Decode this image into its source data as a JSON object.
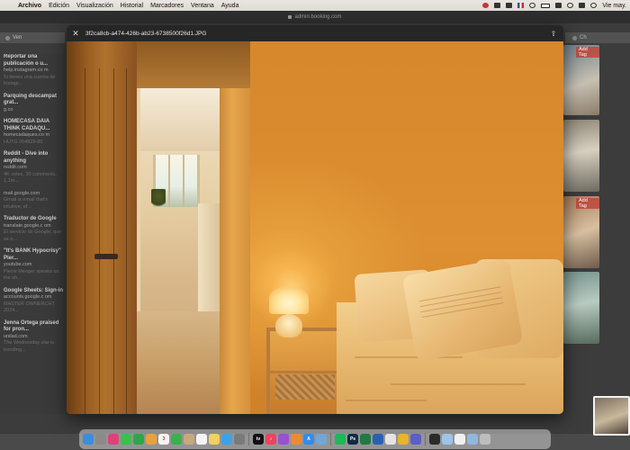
{
  "menubar": {
    "apple_glyph": "",
    "app_name": "Archivo",
    "menus": [
      "Edición",
      "Visualización",
      "Historial",
      "Marcadores",
      "Ventana",
      "Ayuda"
    ],
    "clock": "Vie may."
  },
  "browser": {
    "url": "admin.booking.com",
    "left_tab_label": "Ven",
    "right_tab_label": "Ch"
  },
  "history": [
    {
      "title": "Reportar una publicación o u...",
      "url": "help.instagram.co m",
      "desc": "Si tienes una cuenta de Instagr..."
    },
    {
      "title": "Parquing descampat grat...",
      "url": "g.co",
      "desc": ""
    },
    {
      "title": "HOMECASA DAIA THINK CADAQU...",
      "url": "homecadaques.co m",
      "desc": "HUTG 054829-85"
    },
    {
      "title": "Reddit - Dive into anything",
      "url": "reddit.com",
      "desc": "4K votes, 30 comments. 1.1m..."
    },
    {
      "title": "",
      "url": "mail.google.com",
      "desc": "Gmail is email that's intuitive, ef..."
    },
    {
      "title": "Traductor de Google",
      "url": "translate.google.c om",
      "desc": "El servicio de Google, que se o..."
    },
    {
      "title": "\"It's BANK Hypocrisy\" Pier...",
      "url": "youtube.com",
      "desc": "Pierre Menger speaks on the sh..."
    },
    {
      "title": "Google Sheets: Sign-in",
      "url": "accounts.google.c om",
      "desc": "MASTER OWNERCHT 2024..."
    },
    {
      "title": "Jenna Ortega praised for pron...",
      "url": "unilad.com",
      "desc": "The Wednesday star is trending..."
    }
  ],
  "thumbs": {
    "add_tag": "Add Tag"
  },
  "preview": {
    "filename": "3f2ca8cb-a474-426b-ab23-6738500f26d1.JPG",
    "close_glyph": "✕",
    "share_glyph": "⇪"
  },
  "dock": {
    "icons": [
      {
        "name": "finder",
        "color": "#3b8de0",
        "label": ""
      },
      {
        "name": "launchpad",
        "color": "#8a8a8a",
        "label": ""
      },
      {
        "name": "photos-alt",
        "color": "#e0407a",
        "label": ""
      },
      {
        "name": "messages",
        "color": "#38c24a",
        "label": ""
      },
      {
        "name": "whatsapp",
        "color": "#2aa84a",
        "label": ""
      },
      {
        "name": "photos",
        "color": "#e8a23a",
        "label": ""
      },
      {
        "name": "calendar",
        "color": "#f4f4f4",
        "label": "3"
      },
      {
        "name": "facetime",
        "color": "#36b34a",
        "label": ""
      },
      {
        "name": "contacts",
        "color": "#c9a77d",
        "label": ""
      },
      {
        "name": "reminders",
        "color": "#f4f4f4",
        "label": ""
      },
      {
        "name": "notes",
        "color": "#f1d25a",
        "label": ""
      },
      {
        "name": "safari",
        "color": "#3aa3e8",
        "label": ""
      },
      {
        "name": "settings",
        "color": "#7a7a7a",
        "label": ""
      },
      {
        "name": "tv",
        "color": "#111111",
        "label": "tv"
      },
      {
        "name": "music",
        "color": "#f2415c",
        "label": "♪"
      },
      {
        "name": "podcasts",
        "color": "#9b4fd8",
        "label": ""
      },
      {
        "name": "books",
        "color": "#f28a2c",
        "label": ""
      },
      {
        "name": "appstore",
        "color": "#2e8ef0",
        "label": "A"
      },
      {
        "name": "preview",
        "color": "#6fa7d8",
        "label": ""
      },
      {
        "name": "spotify",
        "color": "#1db954",
        "label": ""
      },
      {
        "name": "photoshop",
        "color": "#0f2a45",
        "label": "Ps"
      },
      {
        "name": "excel",
        "color": "#1f7a44",
        "label": ""
      },
      {
        "name": "word",
        "color": "#2b5fb3",
        "label": ""
      },
      {
        "name": "chrome",
        "color": "#e4e4e4",
        "label": ""
      },
      {
        "name": "vpn",
        "color": "#e8b42a",
        "label": ""
      },
      {
        "name": "teams",
        "color": "#5b5fc7",
        "label": ""
      },
      {
        "name": "terminal",
        "color": "#2b2b2b",
        "label": ""
      },
      {
        "name": "downloads",
        "color": "#9ec4e8",
        "label": ""
      },
      {
        "name": "document",
        "color": "#f0f0f0",
        "label": ""
      },
      {
        "name": "folder",
        "color": "#8fb8e0",
        "label": ""
      },
      {
        "name": "trash",
        "color": "#bdbdbd",
        "label": ""
      }
    ]
  }
}
